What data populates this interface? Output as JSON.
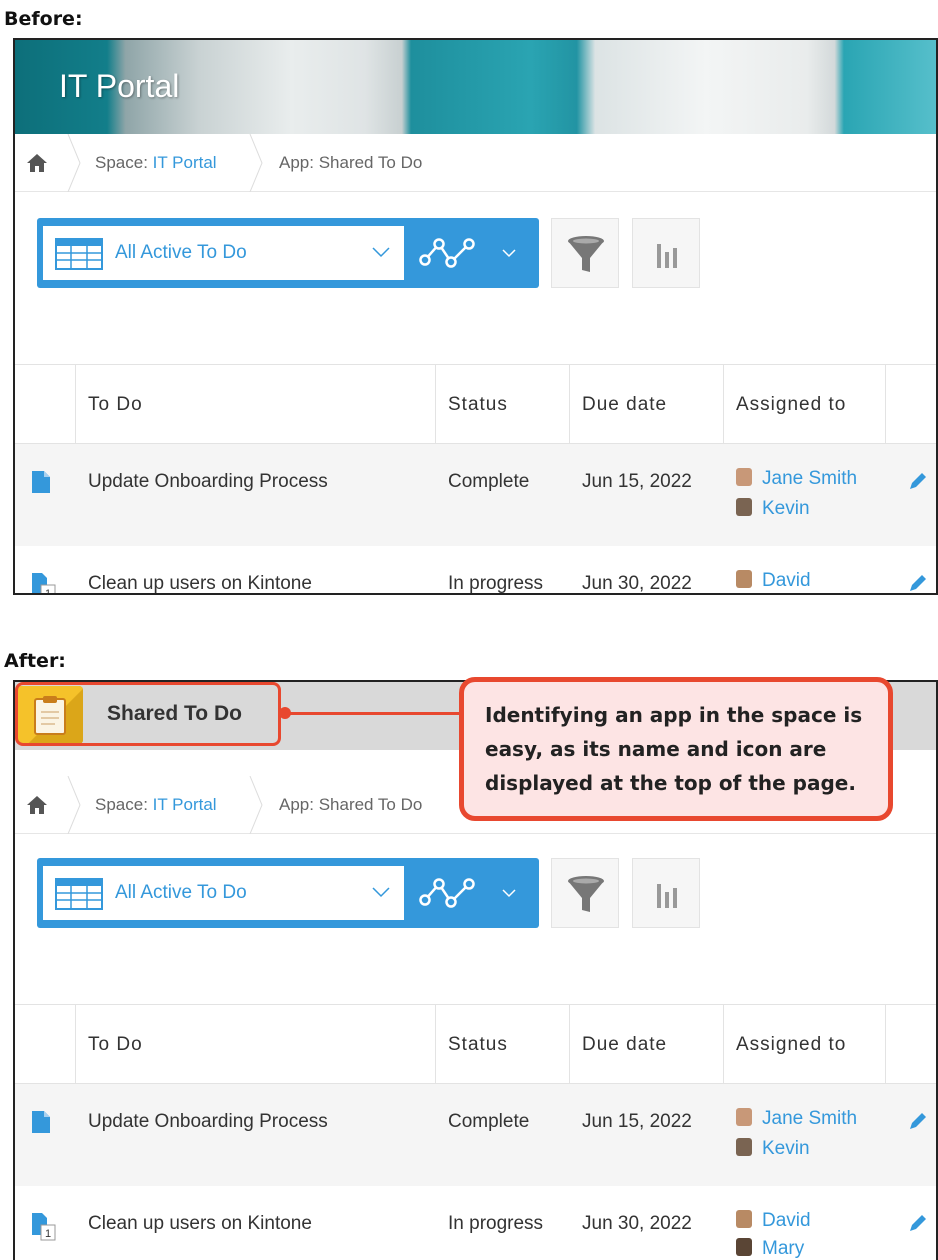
{
  "labels": {
    "before": "Before:",
    "after": "After:"
  },
  "before": {
    "banner_title": "IT Portal"
  },
  "after": {
    "app_name": "Shared To Do",
    "app_icon": "clipboard-icon"
  },
  "breadcrumb": {
    "space_prefix": "Space: ",
    "space_name": "IT Portal",
    "app_crumb": "App: Shared To Do"
  },
  "toolbar": {
    "view_name": "All Active To Do",
    "icons": [
      "table-view-icon",
      "graph-icon",
      "filter-icon",
      "chart-icon"
    ]
  },
  "table": {
    "columns": [
      "To Do",
      "Status",
      "Due date",
      "Assigned to"
    ],
    "rows": [
      {
        "todo": "Update Onboarding Process",
        "status": "Complete",
        "due": "Jun 15, 2022",
        "assignees": [
          "Jane Smith",
          "Kevin"
        ]
      },
      {
        "todo": "Clean up users on Kintone",
        "status": "In progress",
        "due": "Jun 30, 2022",
        "assignees": [
          "David",
          "Mary"
        ],
        "comment_count": "1"
      }
    ]
  },
  "callout": {
    "text": "Identifying an app in the space is easy, as its name and icon are displayed at the top of the page."
  },
  "colors": {
    "accent": "#3498db",
    "callout_border": "#e8482f",
    "callout_bg": "#fde4e4",
    "app_icon": "#f5c22a"
  }
}
